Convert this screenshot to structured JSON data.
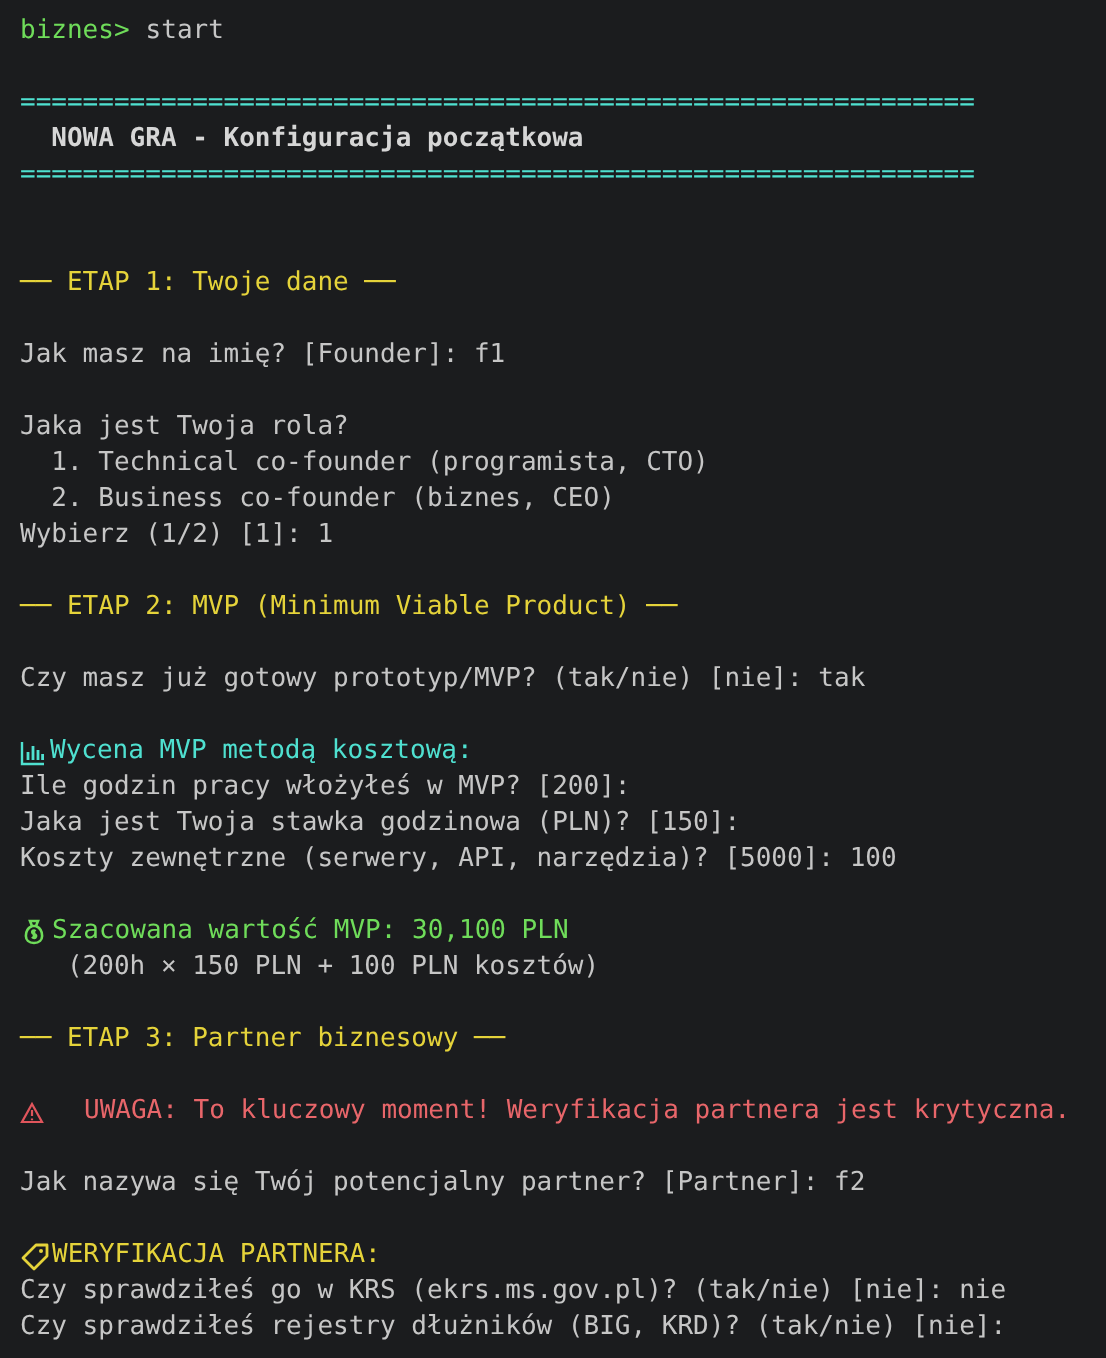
{
  "terminal": {
    "lines": [
      {
        "kind": "prompt",
        "prompt": "biznes>",
        "command": "start"
      },
      {
        "kind": "blank"
      },
      {
        "kind": "rule",
        "text": "============================================================="
      },
      {
        "kind": "title",
        "text": "  NOWA GRA - Konfiguracja początkowa"
      },
      {
        "kind": "rule",
        "text": "============================================================="
      },
      {
        "kind": "blank"
      },
      {
        "kind": "blank"
      },
      {
        "kind": "heading",
        "text": "── ETAP 1: Twoje dane ──"
      },
      {
        "kind": "blank"
      },
      {
        "kind": "text",
        "text": "Jak masz na imię? [Founder]: f1"
      },
      {
        "kind": "blank"
      },
      {
        "kind": "text",
        "text": "Jaka jest Twoja rola?"
      },
      {
        "kind": "text",
        "text": "  1. Technical co-founder (programista, CTO)"
      },
      {
        "kind": "text",
        "text": "  2. Business co-founder (biznes, CEO)"
      },
      {
        "kind": "text",
        "text": "Wybierz (1/2) [1]: 1"
      },
      {
        "kind": "blank"
      },
      {
        "kind": "heading",
        "text": "── ETAP 2: MVP (Minimum Viable Product) ──"
      },
      {
        "kind": "blank"
      },
      {
        "kind": "text",
        "text": "Czy masz już gotowy prototyp/MVP? (tak/nie) [nie]: tak"
      },
      {
        "kind": "blank"
      },
      {
        "kind": "section",
        "text": "Wycena MVP metodą kosztową:"
      },
      {
        "kind": "text",
        "text": "Ile godzin pracy włożyłeś w MVP? [200]:"
      },
      {
        "kind": "text",
        "text": "Jaka jest Twoja stawka godzinowa (PLN)? [150]:"
      },
      {
        "kind": "text",
        "text": "Koszty zewnętrzne (serwery, API, narzędzia)? [5000]: 100"
      },
      {
        "kind": "blank"
      },
      {
        "kind": "success",
        "text": "Szacowana wartość MVP: 30,100 PLN"
      },
      {
        "kind": "text",
        "text": "   (200h × 150 PLN + 100 PLN kosztów)"
      },
      {
        "kind": "blank"
      },
      {
        "kind": "heading",
        "text": "── ETAP 3: Partner biznesowy ──"
      },
      {
        "kind": "blank"
      },
      {
        "kind": "warning",
        "text": "UWAGA: To kluczowy moment! Weryfikacja partnera jest krytyczna."
      },
      {
        "kind": "blank"
      },
      {
        "kind": "text",
        "text": "Jak nazywa się Twój potencjalny partner? [Partner]: f2"
      },
      {
        "kind": "blank"
      },
      {
        "kind": "verify",
        "text": "WERYFIKACJA PARTNERA:"
      },
      {
        "kind": "text",
        "text": "Czy sprawdziłeś go w KRS (ekrs.ms.gov.pl)? (tak/nie) [nie]: nie"
      },
      {
        "kind": "text",
        "text": "Czy sprawdziłeś rejestry dłużników (BIG, KRD)? (tak/nie) [nie]:"
      }
    ]
  }
}
